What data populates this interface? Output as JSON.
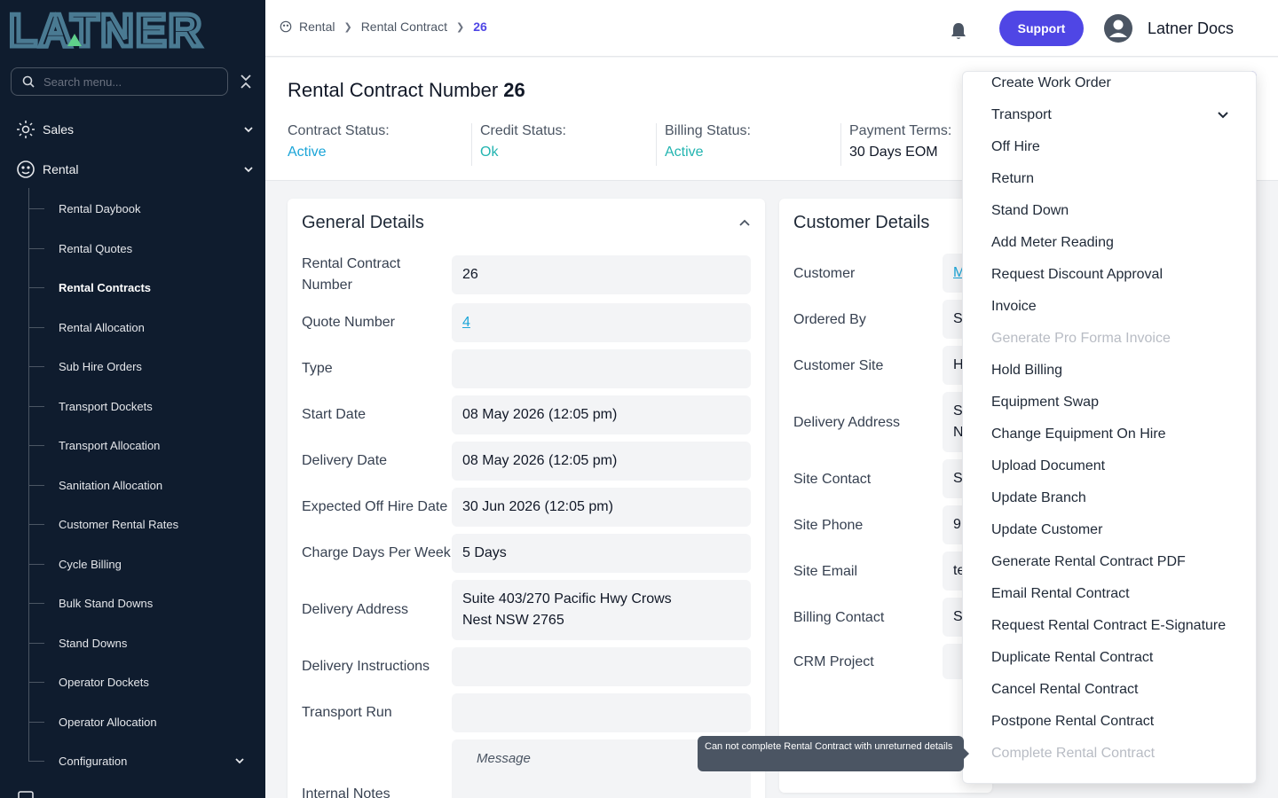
{
  "sidebar": {
    "logo_text": "LATNER",
    "search_placeholder": "Search menu...",
    "top_items": [
      {
        "label": "Sales",
        "icon": "sales-icon"
      },
      {
        "label": "Rental",
        "icon": "rental-icon"
      }
    ],
    "rental_items": [
      "Rental Daybook",
      "Rental Quotes",
      "Rental Contracts",
      "Rental Allocation",
      "Sub Hire Orders",
      "Transport Dockets",
      "Transport Allocation",
      "Sanitation Allocation",
      "Customer Rental Rates",
      "Cycle Billing",
      "Bulk Stand Downs",
      "Stand Downs",
      "Operator Dockets",
      "Operator Allocation",
      "Configuration"
    ],
    "active_item": "Rental Contracts"
  },
  "header": {
    "breadcrumb": [
      "Rental",
      "Rental Contract",
      "26"
    ],
    "support_label": "Support",
    "user_name": "Latner Docs"
  },
  "summary": {
    "title": "Rental Contract Number",
    "number": "26",
    "statuses": [
      {
        "label": "Contract Status:",
        "value": "Active"
      },
      {
        "label": "Credit Status:",
        "value": "Ok"
      },
      {
        "label": "Billing Status:",
        "value": "Active"
      },
      {
        "label": "Payment Terms:",
        "value": "30 Days EOM"
      }
    ]
  },
  "general_details": {
    "title": "General Details",
    "fields": {
      "contract_number_label": "Rental Contract Number",
      "contract_number_value": "26",
      "quote_number_label": "Quote Number",
      "quote_number_value": "4",
      "type_label": "Type",
      "type_value": "",
      "start_date_label": "Start Date",
      "start_date_value": "08 May 2026 (12:05 pm)",
      "delivery_date_label": "Delivery Date",
      "delivery_date_value": "08 May 2026 (12:05 pm)",
      "expected_off_hire_label": "Expected Off Hire Date",
      "expected_off_hire_value": "30 Jun 2026 (12:05 pm)",
      "charge_days_label": "Charge Days Per Week",
      "charge_days_value": "5 Days",
      "delivery_address_label": "Delivery Address",
      "delivery_address_line1": "Suite 403/270 Pacific Hwy Crows",
      "delivery_address_line2": "Nest NSW 2765",
      "delivery_instructions_label": "Delivery Instructions",
      "transport_run_label": "Transport Run",
      "internal_notes_label": "Internal Notes",
      "internal_notes_placeholder": "Message"
    }
  },
  "customer_details": {
    "title": "Customer Details",
    "fields": [
      {
        "label": "Customer",
        "value": "M"
      },
      {
        "label": "Ordered By",
        "value": "S"
      },
      {
        "label": "Customer Site",
        "value": "H"
      },
      {
        "label": "Delivery Address",
        "value": "S",
        "value2": "N"
      },
      {
        "label": "Site Contact",
        "value": "S"
      },
      {
        "label": "Site Phone",
        "value": "9"
      },
      {
        "label": "Site Email",
        "value": "te"
      },
      {
        "label": "Billing Contact",
        "value": "S"
      },
      {
        "label": "CRM Project",
        "value": ""
      }
    ]
  },
  "actions_menu": {
    "items": [
      {
        "label": "Create Work Order",
        "disabled": false
      },
      {
        "label": "Transport",
        "disabled": false
      },
      {
        "label": "Off Hire",
        "disabled": false
      },
      {
        "label": "Return",
        "disabled": false
      },
      {
        "label": "Stand Down",
        "disabled": false
      },
      {
        "label": "Add Meter Reading",
        "disabled": false
      },
      {
        "label": "Request Discount Approval",
        "disabled": false
      },
      {
        "label": "Invoice",
        "disabled": false
      },
      {
        "label": "Generate Pro Forma Invoice",
        "disabled": true
      },
      {
        "label": "Hold Billing",
        "disabled": false
      },
      {
        "label": "Equipment Swap",
        "disabled": false
      },
      {
        "label": "Change Equipment On Hire",
        "disabled": false
      },
      {
        "label": "Upload Document",
        "disabled": false
      },
      {
        "label": "Update Branch",
        "disabled": false
      },
      {
        "label": "Update Customer",
        "disabled": false
      },
      {
        "label": "Generate Rental Contract PDF",
        "disabled": false
      },
      {
        "label": "Email Rental Contract",
        "disabled": false
      },
      {
        "label": "Request Rental Contract E-Signature",
        "disabled": false
      },
      {
        "label": "Duplicate Rental Contract",
        "disabled": false
      },
      {
        "label": "Cancel Rental Contract",
        "disabled": false
      },
      {
        "label": "Postpone Rental Contract",
        "disabled": false
      },
      {
        "label": "Complete Rental Contract",
        "disabled": true
      }
    ]
  },
  "tooltip": {
    "text": "Can not complete Rental Contract with unreturned details"
  },
  "colors": {
    "sidebar_bg": "#0f1c2e",
    "accent": "#4f46e5",
    "status_green": "#22b4b0",
    "status_cyan": "#1ba5d8",
    "disabled_text": "#b8bcc4"
  }
}
